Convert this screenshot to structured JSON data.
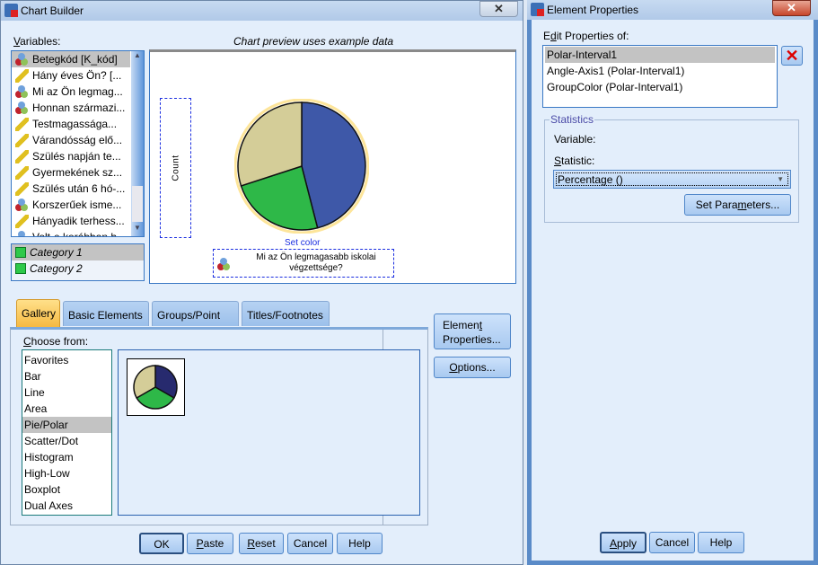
{
  "chart_builder": {
    "title": "Chart Builder",
    "variables_label": "Variables:",
    "preview_note": "Chart preview uses example data",
    "variables": [
      {
        "label": "Betegkód [K_kód]",
        "type": "nominal",
        "selected": true
      },
      {
        "label": "Hány éves Ön? [...",
        "type": "scale"
      },
      {
        "label": "Mi az Ön legmag...",
        "type": "nominal"
      },
      {
        "label": "Honnan származi...",
        "type": "nominal"
      },
      {
        "label": "Testmagassága...",
        "type": "scale"
      },
      {
        "label": "Várandósság elő...",
        "type": "scale"
      },
      {
        "label": "Szülés napján te...",
        "type": "scale"
      },
      {
        "label": "Gyermekének sz...",
        "type": "scale"
      },
      {
        "label": "Szülés után 6 hó-...",
        "type": "scale"
      },
      {
        "label": "Korszerűek isme...",
        "type": "nominal"
      },
      {
        "label": "Hányadik terhess...",
        "type": "scale"
      },
      {
        "label": "Volt-e korábban h...",
        "type": "nominal"
      }
    ],
    "categories": [
      {
        "label": "Category 1",
        "selected": true
      },
      {
        "label": "Category 2"
      }
    ],
    "preview": {
      "y_drop_label": "Count",
      "set_color_label": "Set color",
      "color_var_label": "Mi az Ön legmagasabb iskolai végzettsége?"
    },
    "tabs": [
      {
        "label": "Gallery",
        "active": true
      },
      {
        "label": "Basic Elements"
      },
      {
        "label": "Groups/Point ID"
      },
      {
        "label": "Titles/Footnotes"
      }
    ],
    "choose_from_label": "Choose from:",
    "gallery_types": [
      "Favorites",
      "Bar",
      "Line",
      "Area",
      "Pie/Polar",
      "Scatter/Dot",
      "Histogram",
      "High-Low",
      "Boxplot",
      "Dual Axes"
    ],
    "gallery_selected": "Pie/Polar",
    "side_buttons": {
      "element_properties": "Element Properties...",
      "options": "Options..."
    },
    "buttons": {
      "ok": "OK",
      "paste": "Paste",
      "reset": "Reset",
      "cancel": "Cancel",
      "help": "Help"
    }
  },
  "element_properties": {
    "title": "Element Properties",
    "edit_label": "Edit Properties of:",
    "items": [
      {
        "label": "Polar-Interval1",
        "selected": true
      },
      {
        "label": "Angle-Axis1 (Polar-Interval1)"
      },
      {
        "label": "GroupColor (Polar-Interval1)"
      }
    ],
    "statistics_label": "Statistics",
    "variable_label": "Variable:",
    "statistic_label": "Statistic:",
    "statistic_value": "Percentage ()",
    "set_parameters": "Set Parameters...",
    "buttons": {
      "apply": "Apply",
      "cancel": "Cancel",
      "help": "Help"
    }
  },
  "preview_pie": {
    "slices": [
      {
        "color": "#3e58a8",
        "share": 0.46
      },
      {
        "color": "#2eb848",
        "share": 0.24
      },
      {
        "color": "#d4cd98",
        "share": 0.3
      }
    ]
  },
  "gallery_pie": {
    "slices": [
      {
        "color": "#272a6e",
        "share": 0.3333
      },
      {
        "color": "#2eb848",
        "share": 0.3333
      },
      {
        "color": "#d4cd98",
        "share": 0.3334
      }
    ]
  }
}
